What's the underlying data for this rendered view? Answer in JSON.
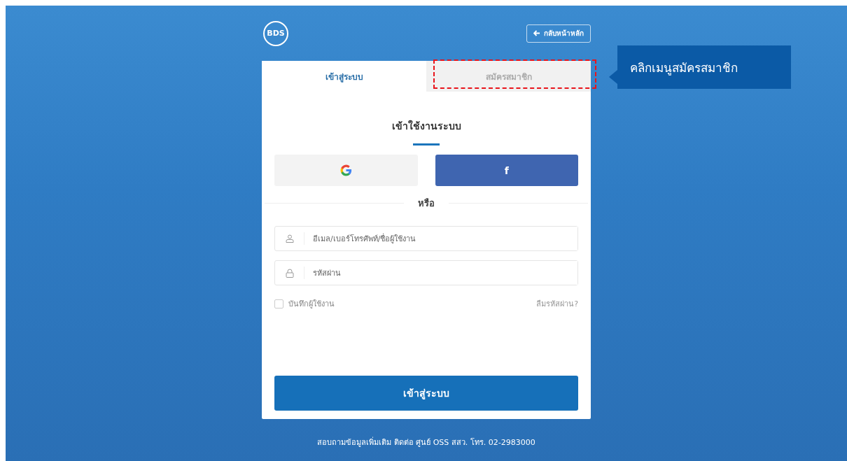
{
  "logo": {
    "text": "BDS"
  },
  "back_button": {
    "label": "กลับหน้าหลัก"
  },
  "tabs": [
    {
      "label": "เข้าสู่ระบบ",
      "selected": true,
      "highlighted": false
    },
    {
      "label": "สมัครสมาชิก",
      "selected": false,
      "highlighted": true
    }
  ],
  "callout": {
    "text": "คลิกเมนูสมัครสมาชิก"
  },
  "heading": "เข้าใช้งานระบบ",
  "social_buttons": [
    {
      "kind": "google"
    },
    {
      "kind": "facebook",
      "label": "f"
    }
  ],
  "divider_text": "หรือ",
  "fields": [
    {
      "kind": "user",
      "placeholder": "อีเมล/เบอร์โทรศัพท์/ชื่อผู้ใช้งาน"
    },
    {
      "kind": "lock",
      "placeholder": "รหัสผ่าน"
    }
  ],
  "remember": {
    "label": "บันทึกผู้ใช้งาน",
    "checked": false
  },
  "forgot_link": "ลืมรหัสผ่าน?",
  "submit_button": "เข้าสู่ระบบ",
  "footer": "สอบถามข้อมูลเพิ่มเติม ติดต่อ ศูนย์ OSS สสว. โทร. 02-2983000"
}
